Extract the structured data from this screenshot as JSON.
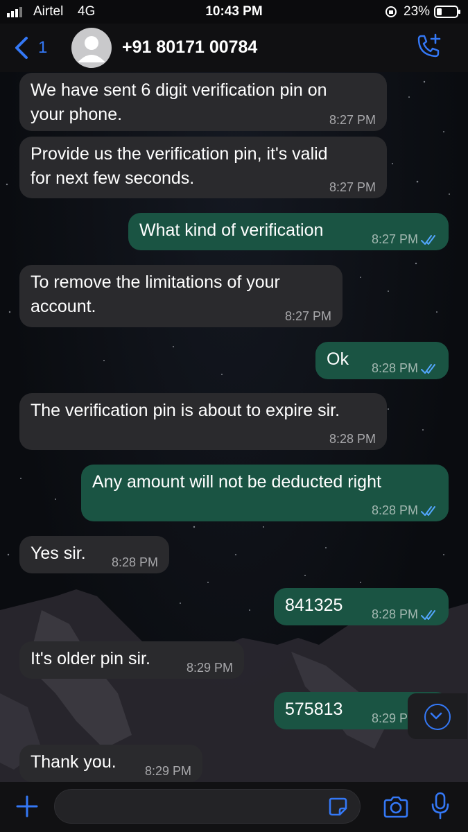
{
  "status": {
    "carrier": "Airtel",
    "network": "4G",
    "time": "10:43 PM",
    "battery": "23%"
  },
  "header": {
    "back_count": "1",
    "contact": "+91 80171 00784"
  },
  "messages": [
    {
      "dir": "in",
      "lines": [
        "We have sent 6 digit verification pin on",
        "your phone."
      ],
      "time": "8:27 PM"
    },
    {
      "dir": "in",
      "lines": [
        "Provide us the verification pin,  it's valid",
        "for next few seconds."
      ],
      "time": "8:27 PM"
    },
    {
      "dir": "out",
      "lines": [
        "What kind of verification"
      ],
      "time": "8:27 PM"
    },
    {
      "dir": "in",
      "lines": [
        "To remove the limitations of your",
        "account."
      ],
      "time": "8:27 PM"
    },
    {
      "dir": "out",
      "lines": [
        "Ok"
      ],
      "time": "8:28 PM"
    },
    {
      "dir": "in",
      "lines": [
        "The verification pin is about to expire sir."
      ],
      "time": "8:28 PM"
    },
    {
      "dir": "out",
      "lines": [
        "Any amount will not be deducted right"
      ],
      "time": "8:28 PM"
    },
    {
      "dir": "in",
      "lines": [
        "Yes sir."
      ],
      "time": "8:28 PM"
    },
    {
      "dir": "out",
      "lines": [
        "841325"
      ],
      "time": "8:28 PM"
    },
    {
      "dir": "in",
      "lines": [
        "It's older pin sir."
      ],
      "time": "8:29 PM"
    },
    {
      "dir": "out",
      "lines": [
        "575813"
      ],
      "time": "8:29 PM"
    },
    {
      "dir": "in",
      "lines": [
        "Thank you."
      ],
      "time": "8:29 PM"
    }
  ],
  "input": {
    "value": "",
    "placeholder": ""
  },
  "colors": {
    "accent": "#3478f6",
    "incoming": "#2a2a2d",
    "outgoing": "#1a5443"
  },
  "icons": [
    "signal-icon",
    "orientation-lock-icon",
    "battery-icon",
    "back-chevron-icon",
    "avatar-icon",
    "add-call-icon",
    "double-check-icon",
    "chevron-down-icon",
    "plus-icon",
    "sticker-icon",
    "camera-icon",
    "microphone-icon"
  ]
}
